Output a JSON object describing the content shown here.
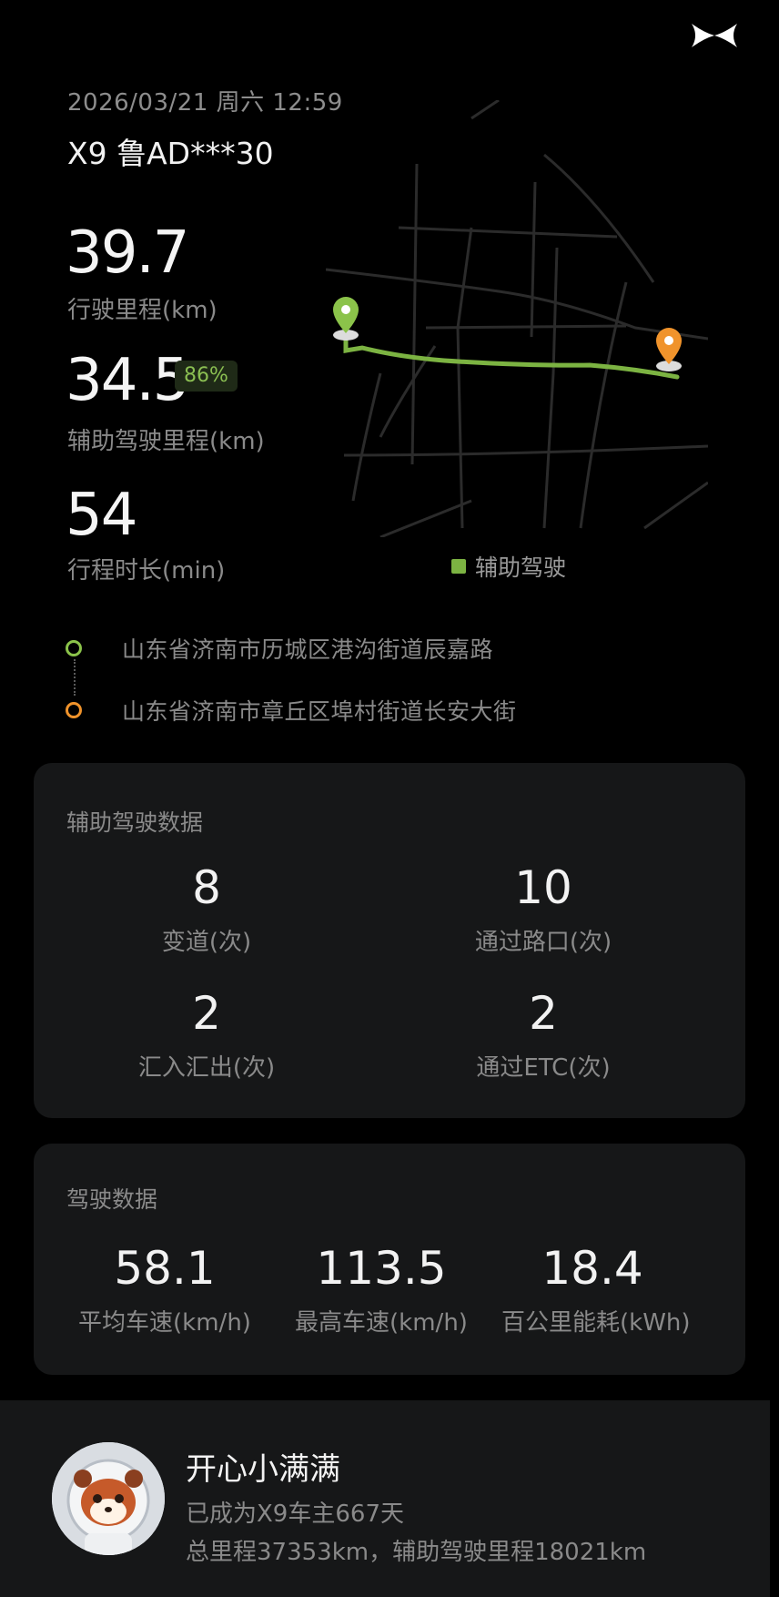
{
  "header": {
    "datetime": "2026/03/21 周六 12:59",
    "vehicle": "X9 鲁AD***30"
  },
  "trip": {
    "distance": "39.7",
    "distance_label": "行驶里程(km)",
    "assist_distance": "34.5",
    "assist_percent": "86%",
    "assist_distance_label": "辅助驾驶里程(km)",
    "duration": "54",
    "duration_label": "行程时长(min)"
  },
  "map": {
    "legend": "辅助驾驶",
    "legend_color": "#7cb342",
    "start_color": "#8bc34a",
    "end_color": "#f0932b"
  },
  "route": {
    "start": "山东省济南市历城区港沟街道辰嘉路",
    "end": "山东省济南市章丘区埠村街道长安大街"
  },
  "assist_card": {
    "title": "辅助驾驶数据",
    "items": [
      {
        "value": "8",
        "label": "变道(次)"
      },
      {
        "value": "10",
        "label": "通过路口(次)"
      },
      {
        "value": "2",
        "label": "汇入汇出(次)"
      },
      {
        "value": "2",
        "label": "通过ETC(次)"
      }
    ]
  },
  "drive_card": {
    "title": "驾驶数据",
    "items": [
      {
        "value": "58.1",
        "label": "平均车速(km/h)"
      },
      {
        "value": "113.5",
        "label": "最高车速(km/h)"
      },
      {
        "value": "18.4",
        "label": "百公里能耗(kWh)"
      }
    ]
  },
  "profile": {
    "name": "开心小满满",
    "owner_line": "已成为X9车主667天",
    "stats_line": "总里程37353km，辅助驾驶里程18021km"
  }
}
